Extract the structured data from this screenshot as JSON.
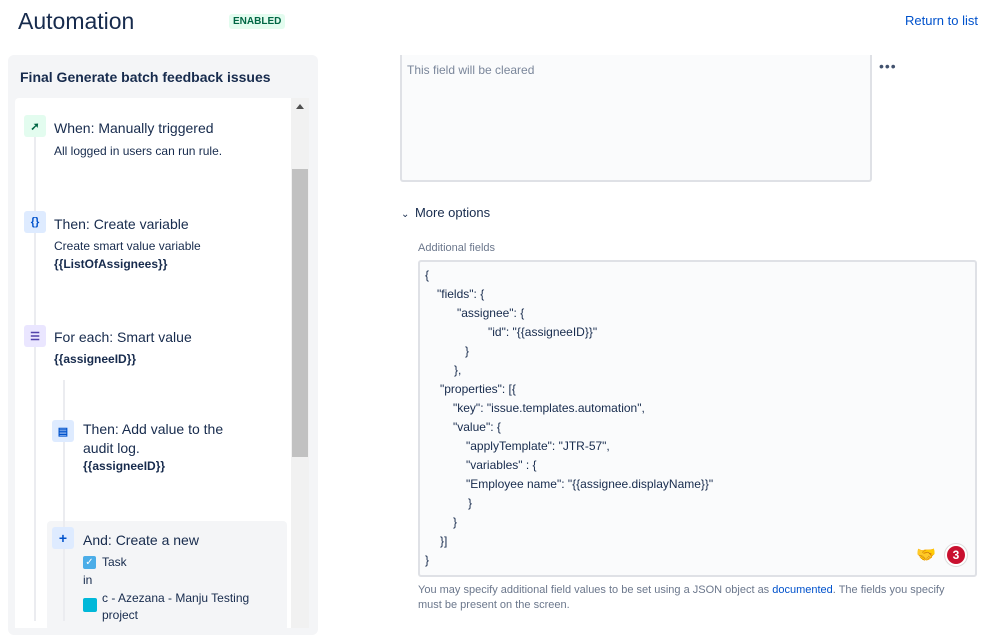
{
  "header": {
    "title": "Automation",
    "status_badge": "ENABLED",
    "return_link": "Return to list"
  },
  "rule": {
    "name": "Final Generate batch feedback issues",
    "steps": [
      {
        "title": "When: Manually triggered",
        "subtitle": "All logged in users can run rule.",
        "icon": "cursor-click-icon"
      },
      {
        "title": "Then: Create variable",
        "subtitle": "Create smart value variable",
        "value": "{{ListOfAssignees}}",
        "icon": "braces-icon"
      },
      {
        "title": "For each: Smart value",
        "value": "{{assigneeID}}",
        "icon": "list-icon"
      },
      {
        "title_line1": "Then: Add value to the",
        "title_line2": "audit log.",
        "value": "{{assigneeID}}",
        "icon": "log-icon"
      },
      {
        "title": "And: Create a new",
        "issue_type": "Task",
        "in": "in",
        "project_line1": "c - Azezana - Manju Testing",
        "project_line2": "project",
        "icon": "plus-icon"
      }
    ]
  },
  "editor": {
    "cleared_placeholder": "This field will be cleared",
    "more_menu": "•••",
    "more_options": "More options",
    "additional_fields_label": "Additional fields",
    "code_lines": [
      "{",
      "\"fields\": {",
      "\"assignee\": {",
      "\"id\": \"{{assigneeID}}\"",
      "}",
      "},",
      "\"properties\": [{",
      "\"key\": \"issue.templates.automation\",",
      "\"value\": {",
      "\"applyTemplate\": \"JTR-57\",",
      "\"variables\" : {",
      "\"Employee name\": \"{{assignee.displayName}}\"",
      "}",
      "}",
      "}]",
      "}"
    ],
    "emoji": "🤝",
    "notification_count": "3",
    "help_text_before": "You may specify additional field values to be set using a JSON object as ",
    "help_link": "documented",
    "help_text_after": ". The fields you specify must be present on the screen."
  },
  "colors": {
    "link": "#0052cc",
    "badge_bg": "#e3fcef",
    "badge_text": "#006644",
    "count_badge": "#c9102f"
  }
}
